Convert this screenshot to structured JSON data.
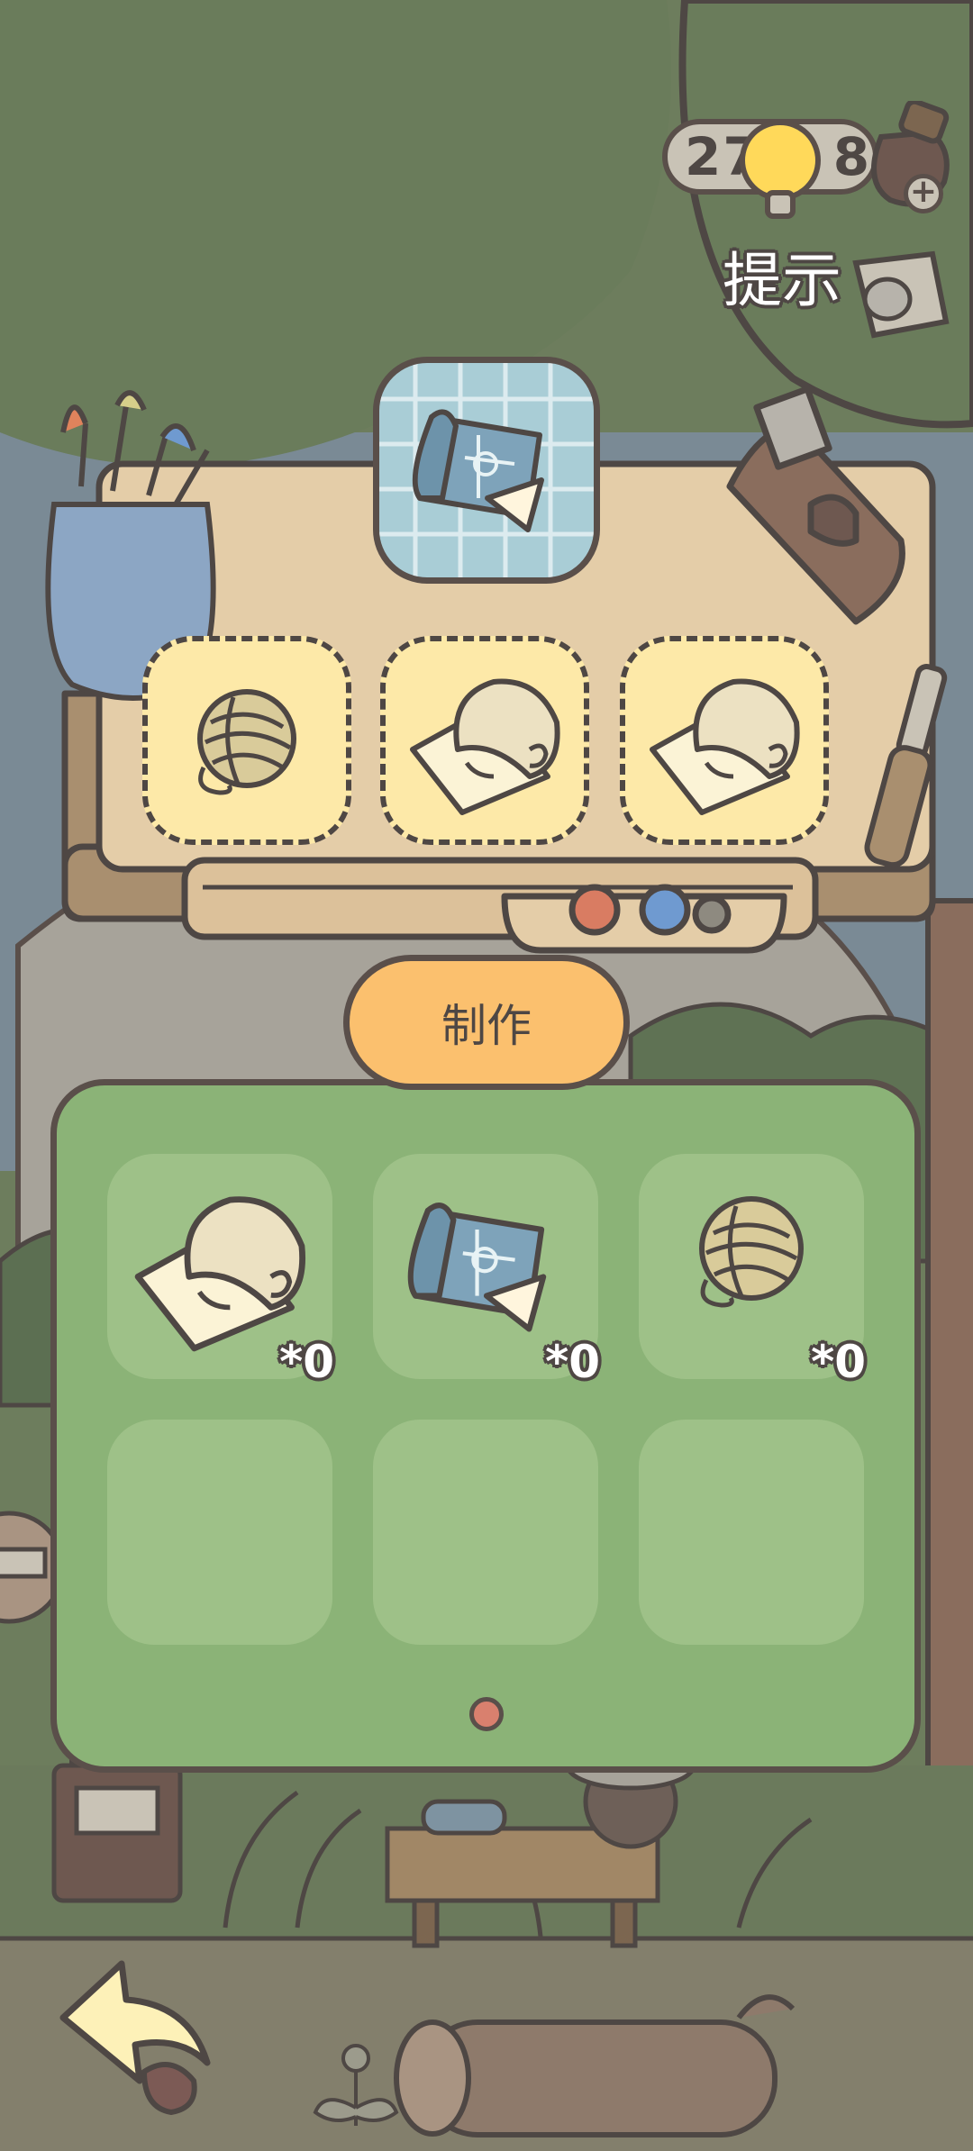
{
  "hud": {
    "coins_left": "27",
    "coins_right": "8",
    "hint_label": "提示"
  },
  "crafting": {
    "target_item": "blueprint-icon",
    "ingredients": [
      "yarn-ball-icon",
      "paper-scroll-icon",
      "paper-scroll-icon"
    ],
    "make_label": "制作"
  },
  "inventory": {
    "items": [
      {
        "icon": "paper-scroll-icon",
        "count": "*0"
      },
      {
        "icon": "blueprint-icon",
        "count": "*0"
      },
      {
        "icon": "yarn-ball-icon",
        "count": "*0"
      }
    ],
    "page_indicator": "1"
  },
  "colors": {
    "panel_green": "#8bb377",
    "button_orange": "#fbc06e",
    "slot_yellow": "#fde9a8",
    "blueprint_blue": "#a9cdd6",
    "outline": "#5a4f4a"
  }
}
